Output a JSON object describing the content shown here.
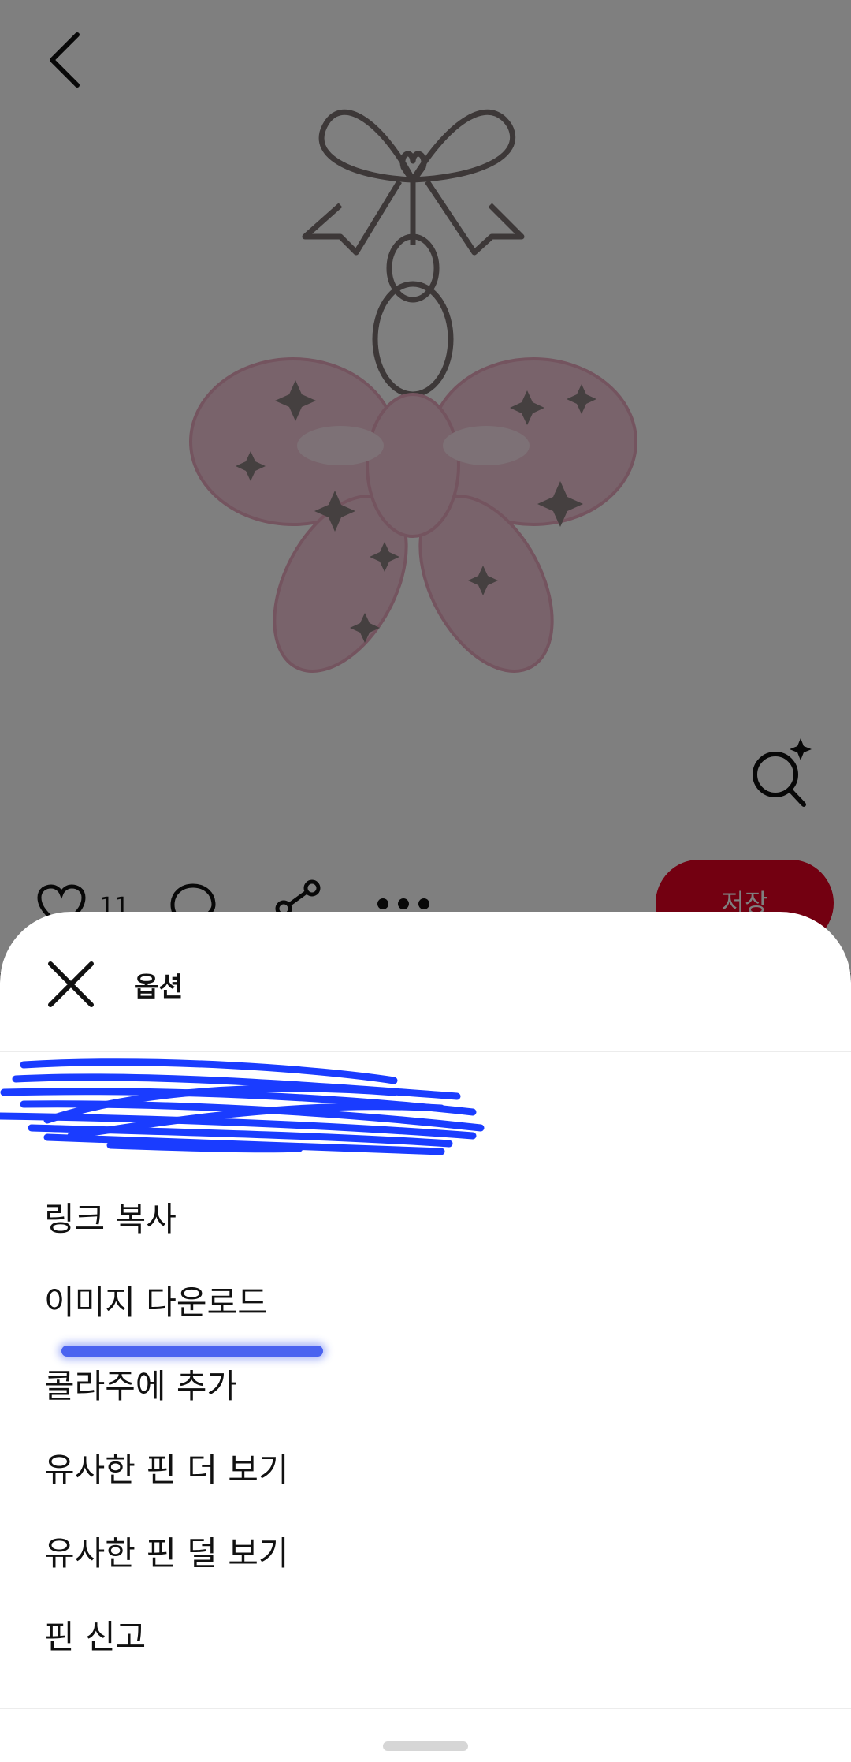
{
  "pin": {
    "like_count": "11",
    "save_label": "저장"
  },
  "sheet": {
    "title": "옵션",
    "items": [
      {
        "label": "링크 복사"
      },
      {
        "label": "이미지 다운로드"
      },
      {
        "label": "콜라주에 추가"
      },
      {
        "label": "유사한 핀 더 보기"
      },
      {
        "label": "유사한 핀 덜 보기"
      },
      {
        "label": "핀 신고"
      }
    ]
  },
  "colors": {
    "save_button": "#e60023",
    "redaction_scribble": "#1a3cff",
    "scrim": "#000000"
  },
  "icons": [
    "back-arrow-icon",
    "visual-search-icon",
    "heart-icon",
    "comment-icon",
    "share-icon",
    "more-icon",
    "close-icon"
  ]
}
